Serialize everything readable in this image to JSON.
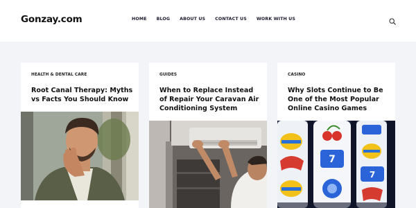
{
  "site": {
    "logo": "Gonzay.com"
  },
  "nav": {
    "items": [
      "HOME",
      "BLOG",
      "ABOUT US",
      "CONTACT US",
      "WORK WITH US"
    ]
  },
  "icons": {
    "search": "search-icon"
  },
  "posts": [
    {
      "category": "HEALTH & DENTAL CARE",
      "title": "Root Canal Therapy: Myths vs Facts You Should Know",
      "image": "man-with-toothache-photo"
    },
    {
      "category": "GUIDES",
      "title": "When to Replace Instead of Repair Your Caravan Air Conditioning System",
      "image": "technician-repairing-air-conditioner-photo"
    },
    {
      "category": "CASINO",
      "title": "Why Slots Continue to Be One of the Most Popular Online Casino Games",
      "image": "slot-machine-reels-photo"
    }
  ]
}
